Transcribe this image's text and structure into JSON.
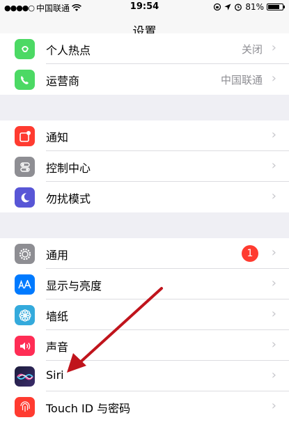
{
  "status_bar": {
    "signal": "●●●●○",
    "carrier": "中国联通",
    "time": "19:54",
    "battery": "81%",
    "battery_level": 0.81
  },
  "nav": {
    "title": "设置"
  },
  "groups": [
    {
      "rows": [
        {
          "label": "个人热点",
          "value": "关闭",
          "icon": "personal-hotspot-icon",
          "color": "#4cd964"
        },
        {
          "label": "运营商",
          "value": "中国联通",
          "icon": "carrier-icon",
          "color": "#4cd964"
        }
      ]
    },
    {
      "rows": [
        {
          "label": "通知",
          "icon": "notifications-icon",
          "color": "#ff3b30"
        },
        {
          "label": "控制中心",
          "icon": "control-center-icon",
          "color": "#8e8e93"
        },
        {
          "label": "勿扰模式",
          "icon": "do-not-disturb-icon",
          "color": "#5856d6"
        }
      ]
    },
    {
      "rows": [
        {
          "label": "通用",
          "badge": "1",
          "icon": "general-gear-icon",
          "color": "#8e8e93"
        },
        {
          "label": "显示与亮度",
          "icon": "display-brightness-icon",
          "color": "#007aff"
        },
        {
          "label": "墙纸",
          "icon": "wallpaper-icon",
          "color": "#34aadc"
        },
        {
          "label": "声音",
          "icon": "sounds-icon",
          "color": "#ff2d55"
        },
        {
          "label": "Siri",
          "icon": "siri-icon",
          "color": "#1c1c3c"
        },
        {
          "label": "Touch ID 与密码",
          "icon": "touch-id-icon",
          "color": "#ff3b30"
        }
      ]
    }
  ],
  "annotation": {
    "icon": "red-pointer-arrow-icon",
    "color": "#c0141c"
  }
}
